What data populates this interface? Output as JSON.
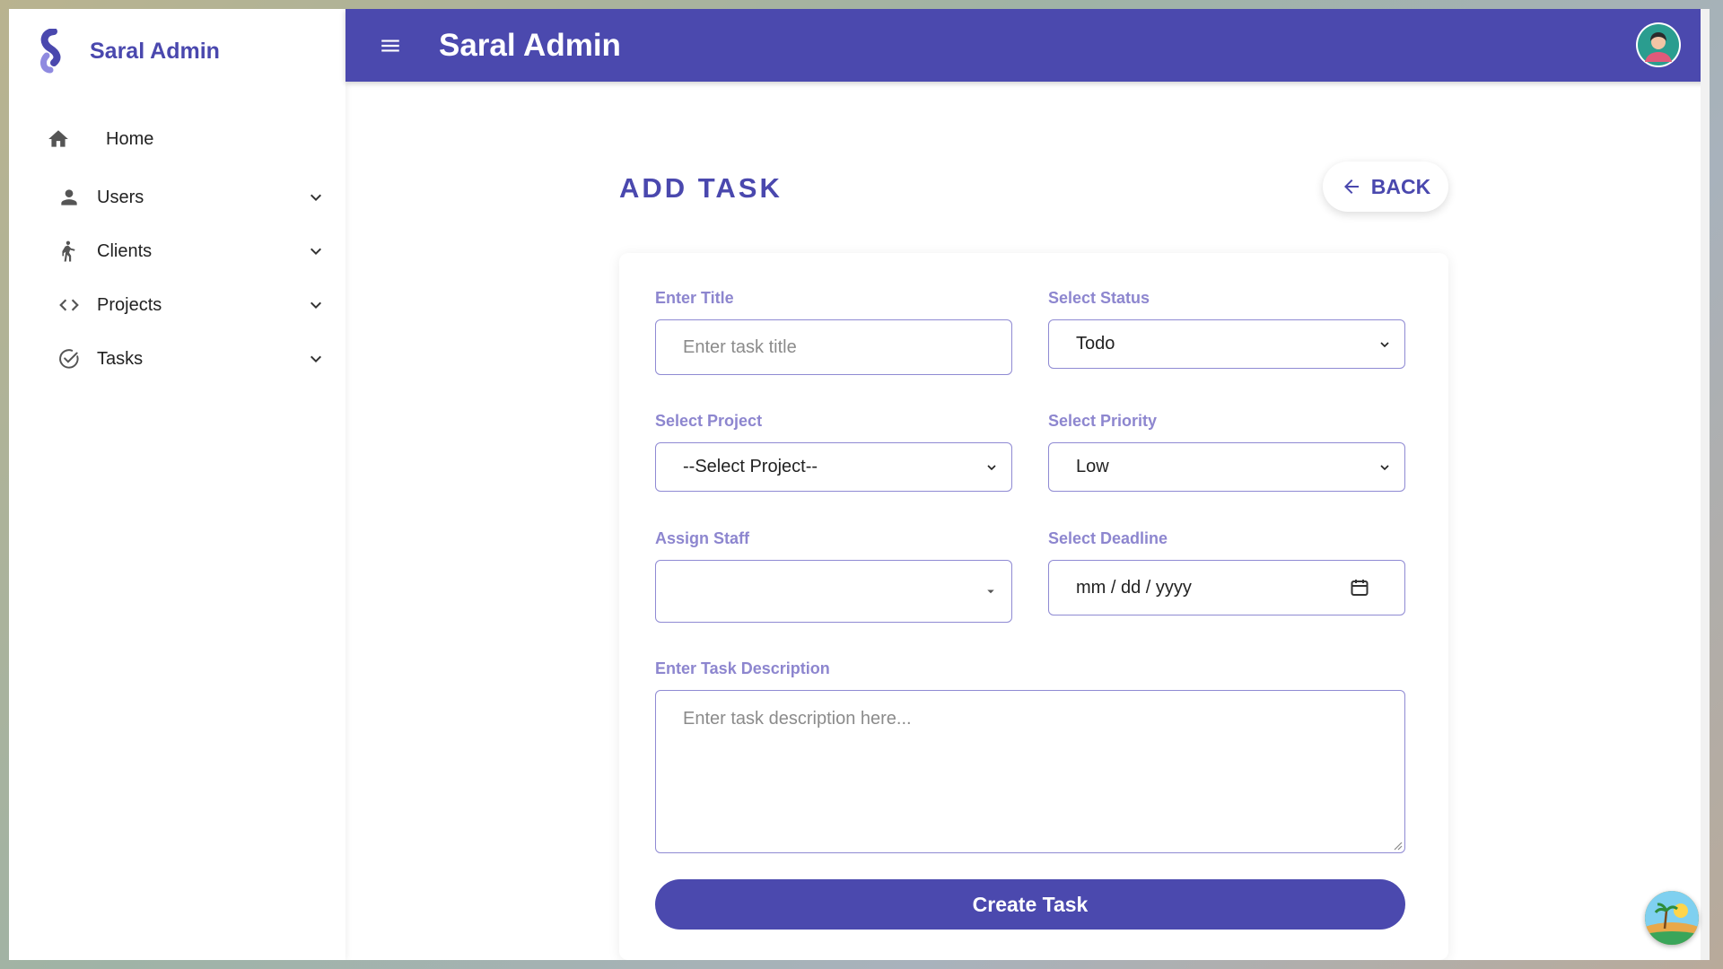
{
  "app": {
    "brand_name": "Saral Admin",
    "header_title": "Saral Admin",
    "accent_color": "#4b49ae",
    "label_color": "#8d86cf"
  },
  "sidebar": {
    "home": {
      "label": "Home",
      "icon": "home-icon"
    },
    "items": [
      {
        "label": "Users",
        "icon": "person-icon"
      },
      {
        "label": "Clients",
        "icon": "figure-icon"
      },
      {
        "label": "Projects",
        "icon": "code-icon"
      },
      {
        "label": "Tasks",
        "icon": "check-circle-icon"
      }
    ]
  },
  "page": {
    "title": "ADD TASK",
    "back_label": "BACK"
  },
  "form": {
    "title": {
      "label": "Enter Title",
      "placeholder": "Enter task title",
      "value": ""
    },
    "status": {
      "label": "Select Status",
      "selected": "Todo"
    },
    "project": {
      "label": "Select Project",
      "selected": "--Select Project--"
    },
    "priority": {
      "label": "Select Priority",
      "selected": "Low"
    },
    "staff": {
      "label": "Assign Staff",
      "selected": ""
    },
    "deadline": {
      "label": "Select Deadline",
      "placeholder": "mm / dd / yyyy"
    },
    "description": {
      "label": "Enter Task Description",
      "placeholder": "Enter task description here..."
    },
    "submit_label": "Create Task"
  }
}
